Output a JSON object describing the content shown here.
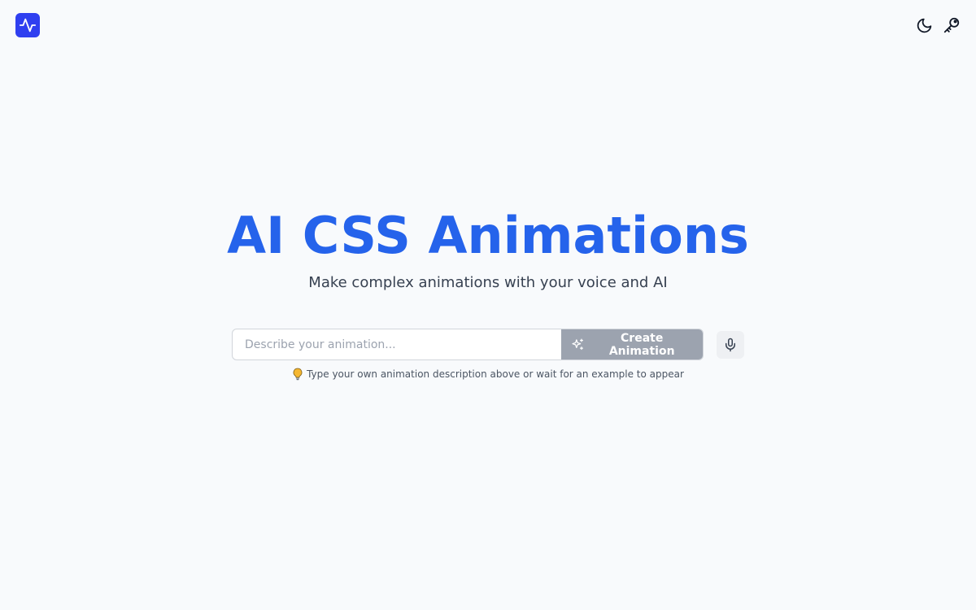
{
  "header": {
    "logo_icon": "activity-pulse-icon",
    "actions": [
      {
        "icon": "moon-icon",
        "label": "dark-mode-toggle"
      },
      {
        "icon": "key-icon",
        "label": "api-key"
      }
    ]
  },
  "hero": {
    "title": "AI CSS Animations",
    "subtitle": "Make complex animations with your voice and AI"
  },
  "prompt": {
    "placeholder": "Describe your animation...",
    "value": "",
    "submit_icon": "sparkles-icon",
    "submit_label": "Create Animation",
    "mic_icon": "microphone-icon"
  },
  "hint": {
    "icon": "lightbulb-icon",
    "text": "Type your own animation description above or wait for an example to appear"
  },
  "colors": {
    "background": "#f8fafc",
    "accent": "#2563eb",
    "logo_bg": "#2f3ff0",
    "button_disabled": "#9ca3af",
    "hint_bulb": "#f5b731"
  }
}
